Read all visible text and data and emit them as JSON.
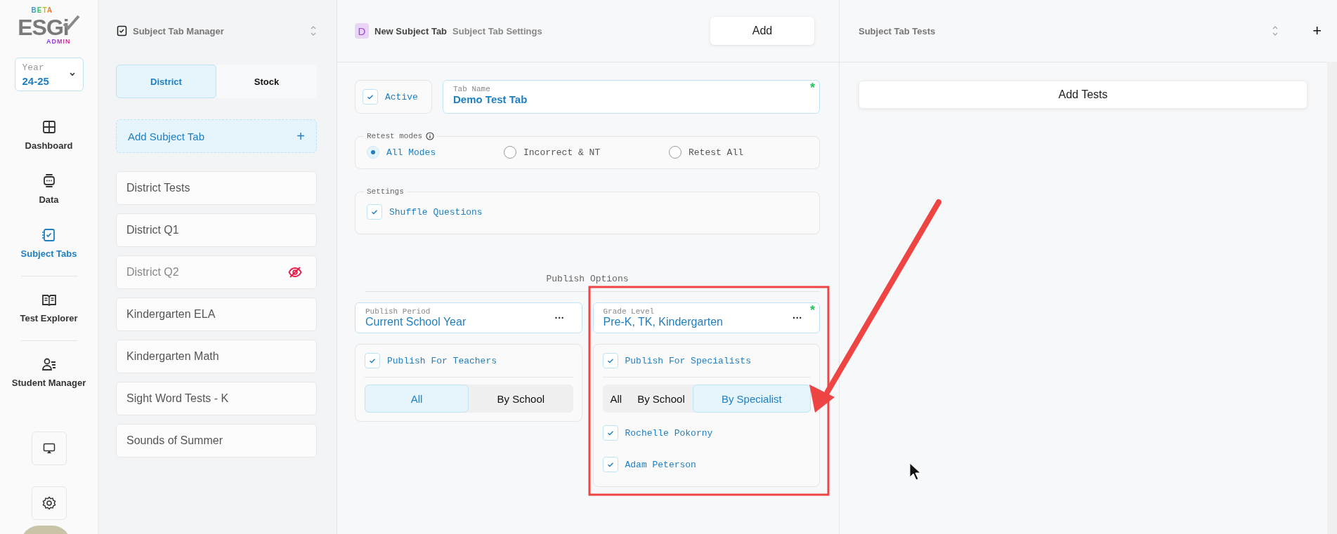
{
  "sidebar": {
    "logo": {
      "badge": "BETA",
      "wordmark": "ESGi",
      "sub": "ADMIN"
    },
    "year": {
      "label": "Year",
      "value": "24-25"
    },
    "nav": [
      {
        "label": "Dashboard",
        "selected": false
      },
      {
        "label": "Data",
        "selected": false
      },
      {
        "label": "Subject Tabs",
        "selected": true
      },
      {
        "label": "Test Explorer",
        "selected": false
      },
      {
        "label": "Student Manager",
        "selected": false
      }
    ]
  },
  "manager": {
    "title": "Subject Tab Manager",
    "tabs": [
      {
        "label": "District",
        "selected": true
      },
      {
        "label": "Stock",
        "selected": false
      }
    ],
    "add_label": "Add Subject Tab",
    "add_icon": "+",
    "items": [
      {
        "label": "District Tests",
        "hidden": false
      },
      {
        "label": "District Q1",
        "hidden": false
      },
      {
        "label": "District Q2",
        "hidden": true
      },
      {
        "label": "Kindergarten ELA",
        "hidden": false
      },
      {
        "label": "Kindergarten Math",
        "hidden": false
      },
      {
        "label": "Sight Word Tests - K",
        "hidden": false
      },
      {
        "label": "Sounds of Summer",
        "hidden": false
      }
    ]
  },
  "settings_panel": {
    "badge": "D",
    "title": "New Subject Tab",
    "subtitle": "Subject Tab Settings",
    "add_button": "Add",
    "active": {
      "label": "Active",
      "checked": true
    },
    "tab_name": {
      "label": "Tab Name",
      "value": "Demo Test Tab",
      "required": true,
      "required_mark": "*"
    },
    "retest": {
      "label": "Retest modes",
      "options": [
        {
          "label": "All Modes",
          "selected": true
        },
        {
          "label": "Incorrect & NT",
          "selected": false
        },
        {
          "label": "Retest All",
          "selected": false
        }
      ]
    },
    "settings": {
      "label": "Settings",
      "options": [
        {
          "label": "Shuffle Questions",
          "checked": true
        }
      ]
    },
    "publish": {
      "title": "Publish Options",
      "period": {
        "label": "Publish Period",
        "value": "Current School Year",
        "menu": "···"
      },
      "grade": {
        "label": "Grade Level",
        "value": "Pre-K, TK, Kindergarten",
        "required": true,
        "required_mark": "*",
        "menu": "···"
      },
      "teachers": {
        "label": "Publish For Teachers",
        "checked": true,
        "segments": [
          {
            "label": "All",
            "selected": true
          },
          {
            "label": "By School",
            "selected": false
          }
        ]
      },
      "specialists": {
        "label": "Publish For Specialists",
        "checked": true,
        "segments": [
          {
            "label": "All",
            "selected": false
          },
          {
            "label": "By School",
            "selected": false
          },
          {
            "label": "By Specialist",
            "selected": true
          }
        ],
        "people": [
          {
            "name": "Rochelle Pokorny",
            "checked": true
          },
          {
            "name": "Adam Peterson",
            "checked": true
          }
        ]
      }
    }
  },
  "tests_panel": {
    "title": "Subject Tab Tests",
    "add_icon": "+",
    "add_button": "Add Tests"
  }
}
